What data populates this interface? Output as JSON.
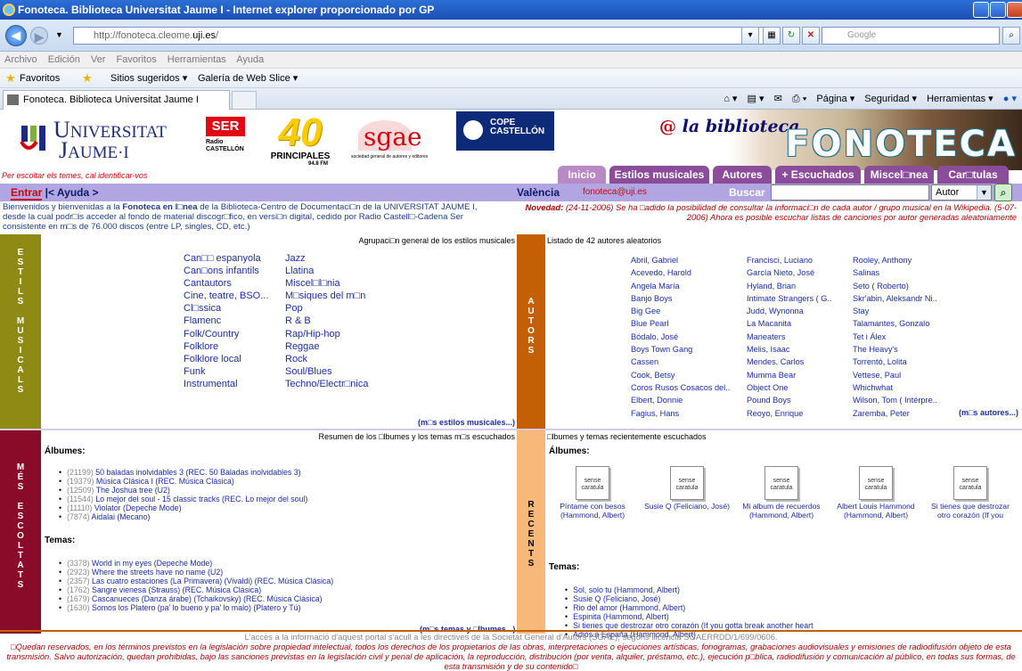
{
  "browser": {
    "title": "Fonoteca. Biblioteca Universitat Jaume I - Internet explorer proporcionado por GP",
    "url_prefix": "http://fonoteca.cleome.",
    "url_domain": "uji.es",
    "url_suffix": "/",
    "search_placeholder": "Google",
    "menu": [
      "Archivo",
      "Edición",
      "Ver",
      "Favoritos",
      "Herramientas",
      "Ayuda"
    ],
    "favorites_label": "Favoritos",
    "fav_items": [
      "Sitios sugeridos ▾",
      "Galería de Web Slice ▾"
    ],
    "tab_title": "Fonoteca. Biblioteca Universitat Jaume I",
    "commands": [
      "Página ▾",
      "Seguridad ▾",
      "Herramientas ▾"
    ]
  },
  "banner": {
    "uji_line1": "NIVERSITAT",
    "uji_line2": "AUME·I",
    "ser_text": "SER",
    "ser_sub": "Radio CASTELLÓN",
    "forty_text": "40",
    "forty_sub": "PRINCIPALES",
    "forty_freq": "94.8 FM",
    "sgae_text": "sgae",
    "sgae_sub": "sociedad general de autores y editores",
    "cope_text": "COPE CASTELLÓN",
    "la_biblioteca": "la biblioteca",
    "at": "@",
    "fonoteca": "FONOTECA"
  },
  "login_hint": "Per escoltar els temes, cal identificar-vos",
  "tabs": [
    "Inicio",
    "Estilos musicales",
    "Autores",
    "+ Escuchados",
    "Miscel□nea",
    "Car□tulas"
  ],
  "navrow": {
    "entrar": "Entrar",
    "ayuda": " |< Ayuda >",
    "city": "València",
    "email": "fonoteca@uji.es",
    "buscar": "Buscar",
    "search_type": "Autor"
  },
  "intro": "Bienvenidos y bienvenidas a la ",
  "intro_bold": "Fonoteca en l□nea",
  "intro_rest": " de la Biblioteca-Centro de Documentaci□n de la UNIVERSITAT JAUME I, desde la cual podr□is acceder al fondo de material discogr□fico, en versi□n digital, cedido por Radio Castell□-Cadena Ser consistente en m□s de 76.000 discos (entre LP, singles, CD, etc.)",
  "novedad_label": "Novedad:",
  "novedad_text": " (24-11-2006) Se ha □adido la posibilidad de consultar la informaci□n de cada autor / grupo musical en la Wikipedia. (5-07-2006) Ahora es posible escuchar listas de canciones por autor generadas aleatoriamente",
  "estils": {
    "label": "ESTILS MUSICALS",
    "header": "Agrupaci□n general de los estilos musicales",
    "col1": [
      "Can□□ espanyola",
      "Can□ons infantils",
      "Cantautors",
      "Cine, teatre, BSO...",
      "Cl□ssica",
      "Flamenc",
      "Folk/Country",
      "Folklore",
      "Folklore local",
      "Funk",
      "Instrumental"
    ],
    "col2": [
      "Jazz",
      "Llatina",
      "Miscel□l□nia",
      "M□siques del m□n",
      "Pop",
      "R & B",
      "Rap/Hip-hop",
      "Reggae",
      "Rock",
      "Soul/Blues",
      "Techno/Electr□nica"
    ],
    "more": "(m□s estilos musicales...)"
  },
  "autors": {
    "label": "AUTORS",
    "header": "Listado de 42 autores aleatorios",
    "col1": [
      "Abril, Gabriel",
      "Acevedo, Harold",
      "Angela María",
      "Banjo Boys",
      "Big Gee",
      "Blue Pearl",
      "Bódalo, José",
      "Boys Town Gang",
      "Cassen",
      "Cook, Betsy",
      "Coros Rusos Cosacos del..",
      "Elbert, Donnie",
      "Fagius, Hans"
    ],
    "col2": [
      "Francisci, Luciano",
      "García Nieto, José",
      "Hyland, Brian",
      "Intimate Strangers ( G..",
      "Judd, Wynonna",
      "La Macanita",
      "Maneaters",
      "Melis, Isaac",
      "Mendes, Carlos",
      "Mumma Bear",
      "Object One",
      "Pound Boys",
      "Reoyo, Enrique"
    ],
    "col3": [
      "Rooley, Anthony",
      "Salinas",
      "Seto ( Roberto)",
      "Skr'abin, Aleksandr Ni..",
      "Stay",
      "Talamantes, Gonzalo",
      "Tet i Álex",
      "The Heavy's",
      "Torrentó, Lolita",
      "Vettese, Paul",
      "Whichwhat",
      "Wilson, Tom ( Intérpre..",
      "Zaremba, Peter"
    ],
    "more": "(m□s autores...)"
  },
  "mes": {
    "label": "MÉS ESCOLTATS",
    "header": "Resumen de los □lbumes y los temas m□s escuchados",
    "albums_title": "Álbumes:",
    "albums": [
      {
        "count": "(21199)",
        "title": "50 baladas inolvidables 3 (REC. 50 Baladas inolvidables 3)"
      },
      {
        "count": "(19379)",
        "title": "Música Clásica I (REC. Música Clásica)"
      },
      {
        "count": "(12509)",
        "title": "The Joshua tree (U2)"
      },
      {
        "count": "(11544)",
        "title": "Lo mejor del soul - 15 classic tracks (REC. Lo mejor del soul)"
      },
      {
        "count": "(11110)",
        "title": "Violator (Depeche Mode)"
      },
      {
        "count": "(7874)",
        "title": "Aidalai (Mecano)"
      }
    ],
    "temas_title": "Temas:",
    "temas": [
      {
        "count": "(3378)",
        "title": "World in my eyes (Depeche Mode)"
      },
      {
        "count": "(2923)",
        "title": "Where the streets have no name (U2)"
      },
      {
        "count": "(2357)",
        "title": "Las cuatro estaciones (La Primavera) (Vivaldi) (REC. Música Clásica)"
      },
      {
        "count": "(1762)",
        "title": "Sangre vienesa (Strauss) (REC. Música Clásica)"
      },
      {
        "count": "(1679)",
        "title": "Cascanueces (Danza árabe) (Tchaikovsky) (REC. Música Clásica)"
      },
      {
        "count": "(1630)",
        "title": "Somos los Platero (pa' lo bueno y pa' lo malo) (Platero y Tú)"
      }
    ],
    "more": "(m□s temas y □lbumes...)"
  },
  "recents": {
    "label": "RECENTS",
    "header": "□lbumes y temas recientemente escuchados",
    "albums_title": "Álbumes:",
    "cover_text": "sense caratula",
    "albums": [
      {
        "line1": "Píntame con besos",
        "line2": "(Hammond, Albert)"
      },
      {
        "line1": "Susie Q (Feliciano, José)",
        "line2": ""
      },
      {
        "line1": "Mi album de recuerdos",
        "line2": "(Hammond, Albert)"
      },
      {
        "line1": "Albert Louis Hammond",
        "line2": "(Hammond, Albert)"
      },
      {
        "line1": "Si tienes que destrozar",
        "line2": "otro corazón (If you"
      }
    ],
    "temas_title": "Temas:",
    "temas": [
      "Sol, solo tu (Hammond, Albert)",
      "Susie Q (Feliciano, José)",
      "Rio del amor (Hammond, Albert)",
      "Espinita (Hammond, Albert)",
      "Si tienes que destrozar otro corazón (If you gotta break another heart",
      "Adiós a España (Hammond, Albert)"
    ]
  },
  "footer": {
    "line1": "L'accés a la informació d'aquest portal s'acull a les directives de la Societat General d'Autors (SGAE), segons llicència SGAERRDD/1/699/0606.",
    "line2": "□Quedan reservados, en los términos previstos en la legislación sobre propiedad intelectual, todos los derechos de los propietarios de las obras, interpretaciones o ejecuciones artísticas, fonogramas, grabaciones audiovisuales y emisiones de radiodifusión objeto de esta transmisión. Salvo autorización, quedan prohibidas, bajo las sanciones previstas en la legislación civil y penal de aplicación, la reproducción, distribución (por venta, alquiler, préstamo, etc.), ejecución p□blica, radiodifusión y comunicación al público, en todas sus formas, de esta transmisión y de su contenido□"
  },
  "colors": {
    "estils": "#8f8a14",
    "autors": "#c45f05",
    "mes": "#8a0a2a",
    "recents": "#f8b87a",
    "tab": "#8b4d9a",
    "navrow": "#b2a6e2"
  }
}
